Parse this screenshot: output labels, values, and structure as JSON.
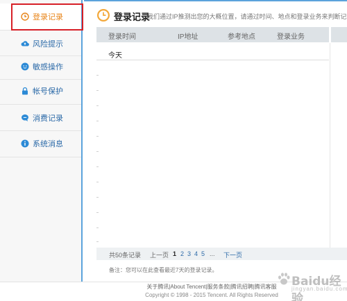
{
  "sidebar": {
    "items": [
      {
        "label": "登录记录",
        "icon": "clock-icon"
      },
      {
        "label": "风险提示",
        "icon": "cloud-upload-icon"
      },
      {
        "label": "敏感操作",
        "icon": "smiley-icon"
      },
      {
        "label": "帐号保护",
        "icon": "lock-icon"
      },
      {
        "label": "消费记录",
        "icon": "chat-bubble-icon"
      },
      {
        "label": "系统消息",
        "icon": "info-icon"
      }
    ],
    "active_index": 0
  },
  "header": {
    "title": "登录记录",
    "description": "我们通过IP推测出您的大概位置，请通过时间、地点和登录业务来判断记录是否正常。"
  },
  "table": {
    "columns": [
      "登录时间",
      "IP地址",
      "参考地点",
      "登录业务"
    ],
    "group_label": "今天"
  },
  "pagination": {
    "total_text": "共50条记录",
    "prev_label": "上一页",
    "pages": [
      "1",
      "2",
      "3",
      "4",
      "5"
    ],
    "current_page": "1",
    "ellipsis": "...",
    "next_label": "下一页"
  },
  "note": "备注：您可以在此查看最近7天的登录记录。",
  "footer": {
    "links": "关于腾讯|About Tencent|服务条款|腾讯招聘|腾讯客服",
    "copyright": "Copyright © 1998 - 2015 Tencent. All Rights Reserved"
  },
  "watermark": {
    "text": "Baidu经验",
    "sub": "jingyan.baidu.com"
  },
  "colors": {
    "accent_blue": "#5ba3dc",
    "active_orange": "#e8851a",
    "link_blue": "#2c6aa8",
    "highlight_red": "#d71f26"
  }
}
